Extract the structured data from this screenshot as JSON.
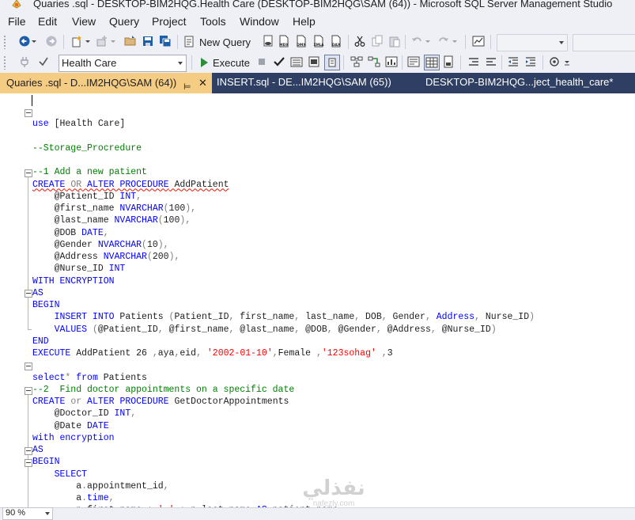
{
  "window": {
    "title": "Quaries .sql - DESKTOP-BIM2HQG.Health Care (DESKTOP-BIM2HQG\\SAM (64)) - Microsoft SQL Server Management Studio"
  },
  "menu": [
    "File",
    "Edit",
    "View",
    "Query",
    "Project",
    "Tools",
    "Window",
    "Help"
  ],
  "toolbar": {
    "new_query_label": "New Query",
    "icon_captions": [
      "MDX",
      "DMX",
      "XMLA",
      "DAX"
    ],
    "database": "Health Care",
    "execute_label": "Execute"
  },
  "tabs": [
    {
      "label": "Quaries .sql - D...IM2HQG\\SAM (64))",
      "pin": "⊨",
      "close": "✕"
    },
    {
      "label": "INSERT.sql - DE...IM2HQG\\SAM (65))"
    },
    {
      "label": "DESKTOP-BIM2HQG...ject_health_care*"
    }
  ],
  "code_lines": [
    [],
    [
      [
        "kw",
        "use"
      ],
      [
        "pl",
        " [Health Care]"
      ]
    ],
    [],
    [
      [
        "cm",
        "--Storage_Procredure"
      ]
    ],
    [],
    [
      [
        "cm",
        "--1 Add a new patient"
      ]
    ],
    [
      [
        "kw",
        "CREATE"
      ],
      [
        "pl",
        " "
      ],
      [
        "gy",
        "OR"
      ],
      [
        "pl",
        " "
      ],
      [
        "kw",
        "ALTER PROCEDURE"
      ],
      [
        "pl",
        " AddPatient"
      ]
    ],
    [
      [
        "pl",
        "    @Patient_ID "
      ],
      [
        "kw",
        "INT"
      ],
      [
        "gy",
        ","
      ]
    ],
    [
      [
        "pl",
        "    @first_name "
      ],
      [
        "kw",
        "NVARCHAR"
      ],
      [
        "gy",
        "("
      ],
      [
        "pl",
        "100"
      ],
      [
        "gy",
        "),"
      ]
    ],
    [
      [
        "pl",
        "    @last_name "
      ],
      [
        "kw",
        "NVARCHAR"
      ],
      [
        "gy",
        "("
      ],
      [
        "pl",
        "100"
      ],
      [
        "gy",
        "),"
      ]
    ],
    [
      [
        "pl",
        "    @DOB "
      ],
      [
        "kw",
        "DATE"
      ],
      [
        "gy",
        ","
      ]
    ],
    [
      [
        "pl",
        "    @Gender "
      ],
      [
        "kw",
        "NVARCHAR"
      ],
      [
        "gy",
        "("
      ],
      [
        "pl",
        "10"
      ],
      [
        "gy",
        "),"
      ]
    ],
    [
      [
        "pl",
        "    @Address "
      ],
      [
        "kw",
        "NVARCHAR"
      ],
      [
        "gy",
        "("
      ],
      [
        "pl",
        "200"
      ],
      [
        "gy",
        "),"
      ]
    ],
    [
      [
        "pl",
        "    @Nurse_ID "
      ],
      [
        "kw",
        "INT"
      ]
    ],
    [
      [
        "kw",
        "WITH ENCRYPTION"
      ]
    ],
    [
      [
        "kw",
        "AS"
      ]
    ],
    [
      [
        "kw",
        "BEGIN"
      ]
    ],
    [
      [
        "pl",
        "    "
      ],
      [
        "kw",
        "INSERT INTO"
      ],
      [
        "pl",
        " Patients "
      ],
      [
        "gy",
        "("
      ],
      [
        "pl",
        "Patient_ID"
      ],
      [
        "gy",
        ","
      ],
      [
        "pl",
        " first_name"
      ],
      [
        "gy",
        ","
      ],
      [
        "pl",
        " last_name"
      ],
      [
        "gy",
        ","
      ],
      [
        "pl",
        " DOB"
      ],
      [
        "gy",
        ","
      ],
      [
        "pl",
        " Gender"
      ],
      [
        "gy",
        ","
      ],
      [
        "pl",
        " "
      ],
      [
        "kw",
        "Address"
      ],
      [
        "gy",
        ","
      ],
      [
        "pl",
        " Nurse_ID"
      ],
      [
        "gy",
        ")"
      ]
    ],
    [
      [
        "pl",
        "    "
      ],
      [
        "kw",
        "VALUES"
      ],
      [
        "pl",
        " "
      ],
      [
        "gy",
        "("
      ],
      [
        "pl",
        "@Patient_ID"
      ],
      [
        "gy",
        ","
      ],
      [
        "pl",
        " @first_name"
      ],
      [
        "gy",
        ","
      ],
      [
        "pl",
        " @last_name"
      ],
      [
        "gy",
        ","
      ],
      [
        "pl",
        " @DOB"
      ],
      [
        "gy",
        ","
      ],
      [
        "pl",
        " @Gender"
      ],
      [
        "gy",
        ","
      ],
      [
        "pl",
        " @Address"
      ],
      [
        "gy",
        ","
      ],
      [
        "pl",
        " @Nurse_ID"
      ],
      [
        "gy",
        ")"
      ]
    ],
    [
      [
        "kw",
        "END"
      ]
    ],
    [
      [
        "kw",
        "EXECUTE"
      ],
      [
        "pl",
        " AddPatient 26 "
      ],
      [
        "gy",
        ","
      ],
      [
        "pl",
        "aya"
      ],
      [
        "gy",
        ","
      ],
      [
        "pl",
        "eid"
      ],
      [
        "gy",
        ","
      ],
      [
        "pl",
        " "
      ],
      [
        "st",
        "'2002-01-10'"
      ],
      [
        "gy",
        ","
      ],
      [
        "pl",
        "Female "
      ],
      [
        "gy",
        ","
      ],
      [
        "st",
        "'123sohag'"
      ],
      [
        "pl",
        " "
      ],
      [
        "gy",
        ","
      ],
      [
        "pl",
        "3"
      ]
    ],
    [],
    [
      [
        "kw",
        "select"
      ],
      [
        "gy",
        "*"
      ],
      [
        "pl",
        " "
      ],
      [
        "kw",
        "from"
      ],
      [
        "pl",
        " Patients"
      ]
    ],
    [
      [
        "cm",
        "--2  Find doctor appointments on a specific date"
      ]
    ],
    [
      [
        "kw",
        "CREATE"
      ],
      [
        "pl",
        " "
      ],
      [
        "gy",
        "or"
      ],
      [
        "pl",
        " "
      ],
      [
        "kw",
        "ALTER PROCEDURE"
      ],
      [
        "pl",
        " GetDoctorAppointments"
      ]
    ],
    [
      [
        "pl",
        "    @Doctor_ID "
      ],
      [
        "kw",
        "INT"
      ],
      [
        "gy",
        ","
      ]
    ],
    [
      [
        "pl",
        "    @Date "
      ],
      [
        "kw",
        "DATE"
      ]
    ],
    [
      [
        "kw",
        "with encryption"
      ]
    ],
    [
      [
        "kw",
        "AS"
      ]
    ],
    [
      [
        "kw",
        "BEGIN"
      ]
    ],
    [
      [
        "pl",
        "    "
      ],
      [
        "kw",
        "SELECT"
      ]
    ],
    [
      [
        "pl",
        "        a"
      ],
      [
        "gy",
        "."
      ],
      [
        "pl",
        "appointment_id"
      ],
      [
        "gy",
        ","
      ]
    ],
    [
      [
        "pl",
        "        a"
      ],
      [
        "gy",
        "."
      ],
      [
        "kw",
        "time"
      ],
      [
        "gy",
        ","
      ]
    ],
    [
      [
        "pl",
        "        p"
      ],
      [
        "gy",
        "."
      ],
      [
        "pl",
        "first_name "
      ],
      [
        "gy",
        "+"
      ],
      [
        "pl",
        " "
      ],
      [
        "st",
        "' '"
      ],
      [
        "pl",
        " "
      ],
      [
        "gy",
        "+"
      ],
      [
        "pl",
        " p"
      ],
      [
        "gy",
        "."
      ],
      [
        "pl",
        "last_name "
      ],
      [
        "kw",
        "AS"
      ],
      [
        "pl",
        " patient_name"
      ],
      [
        "gy",
        ","
      ]
    ]
  ],
  "watermark": {
    "line1": "نفذلي",
    "line2": "nafezly.com"
  },
  "status": {
    "zoom": "90 %"
  }
}
